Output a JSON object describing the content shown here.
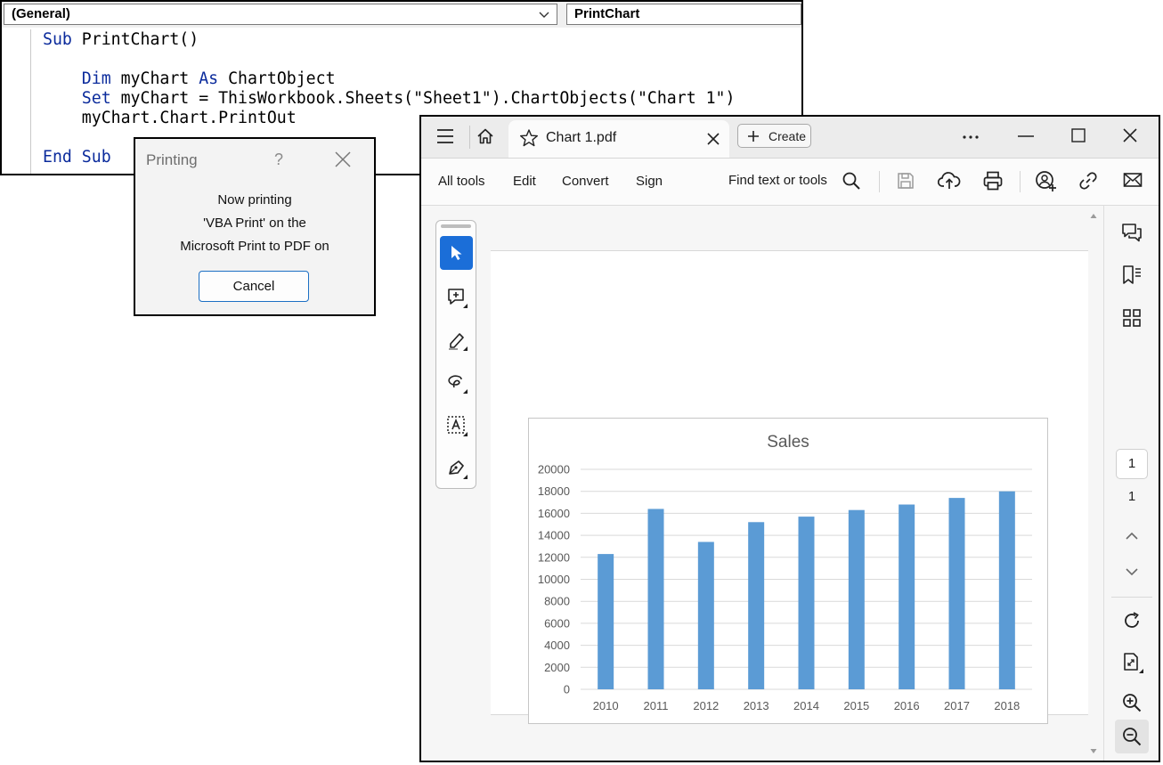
{
  "vba": {
    "object_combo": "(General)",
    "proc_combo": "PrintChart",
    "code": [
      {
        "kw": "Sub",
        "rest": " PrintChart()"
      },
      {
        "kw": "",
        "rest": ""
      },
      {
        "kw": "    Dim",
        "rest": " myChart ",
        "kw2": "As",
        "rest2": " ChartObject"
      },
      {
        "kw": "    Set",
        "rest": " myChart = ThisWorkbook.Sheets(\"Sheet1\").ChartObjects(\"Chart 1\")"
      },
      {
        "kw": "",
        "rest": "    myChart.Chart.PrintOut"
      },
      {
        "kw": "",
        "rest": ""
      },
      {
        "kw": "End Sub",
        "rest": ""
      }
    ]
  },
  "print_dialog": {
    "title": "Printing",
    "help": "?",
    "line1": "Now printing",
    "line2": "'VBA Print' on the",
    "line3": "Microsoft Print to PDF on",
    "cancel": "Cancel"
  },
  "acrobat": {
    "tab_title": "Chart 1.pdf",
    "create_label": "Create",
    "menu": [
      "All tools",
      "Edit",
      "Convert",
      "Sign"
    ],
    "find_label": "Find text or tools",
    "page_current": "1",
    "page_total": "1"
  },
  "colors": {
    "keyword": "#0b2b9c",
    "bar": "#5b9bd5",
    "accent": "#1b6ed8"
  },
  "chart_data": {
    "type": "bar",
    "title": "Sales",
    "categories": [
      "2010",
      "2011",
      "2012",
      "2013",
      "2014",
      "2015",
      "2016",
      "2017",
      "2018"
    ],
    "values": [
      12300,
      16400,
      13400,
      15200,
      15700,
      16300,
      16800,
      17400,
      18000
    ],
    "yticks": [
      "0",
      "2000",
      "4000",
      "6000",
      "8000",
      "10000",
      "12000",
      "14000",
      "16000",
      "18000",
      "20000"
    ],
    "ylim": [
      0,
      20000
    ],
    "grid": true,
    "legend": "none"
  }
}
